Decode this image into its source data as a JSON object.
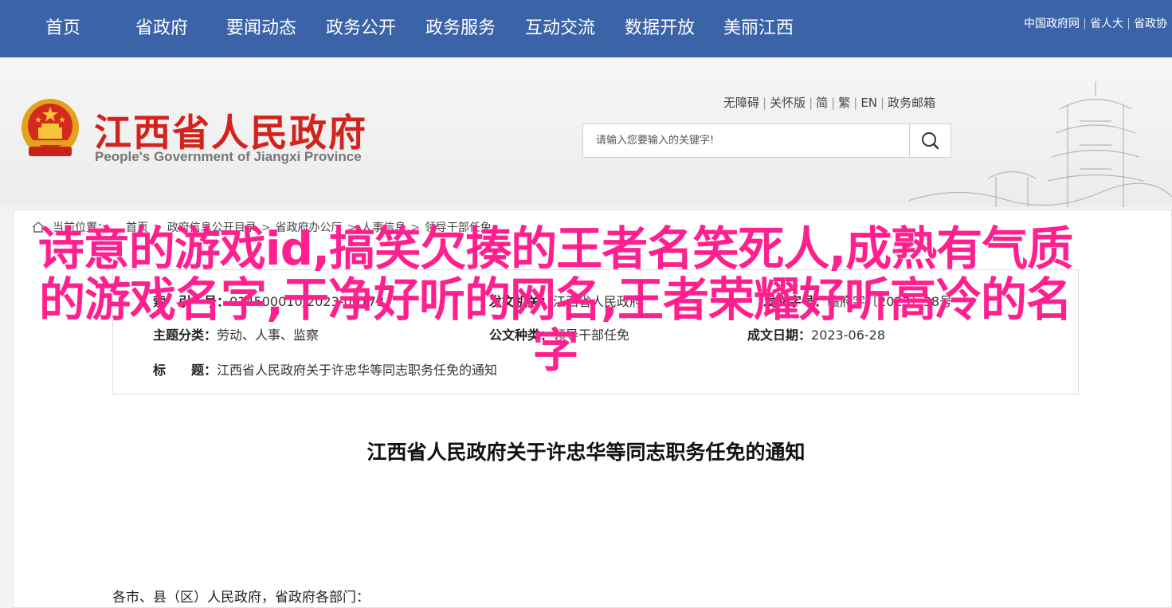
{
  "topnav": {
    "items": [
      "首页",
      "省政府",
      "要闻动态",
      "政务公开",
      "政务服务",
      "互动交流",
      "数据开放",
      "美丽江西"
    ],
    "links": [
      "中国政府网",
      "省人大",
      "省政协"
    ]
  },
  "header": {
    "title": "江西省人民政府",
    "subtitle": "People's Government of Jiangxi Province",
    "util_links": [
      "无障碍",
      "关怀版",
      "简",
      "繁",
      "EN",
      "政务邮箱"
    ],
    "search_placeholder": "请输入您要输入的关键字!"
  },
  "breadcrumb": {
    "label": "当前位置：",
    "items": [
      "首页",
      "政府信息公开目录",
      "省政府办公厅",
      "人事信息",
      "领导干部任免"
    ]
  },
  "info": {
    "index_label": "索　引　号：",
    "index_value": "014500010/2023-00173",
    "issuer_label": "发文机关：",
    "issuer_value": "江西省人民政府",
    "docno_label": "发文字号：",
    "docno_value": "赣府字〔2023〕38号",
    "category_label": "主题分类：",
    "category_value": "劳动、人事、监察",
    "doctype_label": "公文种类：",
    "doctype_value": "领导干部任免",
    "date_label": "成文日期：",
    "date_value": "2023-06-28",
    "title_label": "标　　题：",
    "title_value": "江西省人民政府关于许忠华等同志职务任免的通知"
  },
  "document": {
    "title": "江西省人民政府关于许忠华等同志职务任免的通知",
    "salutation": "各市、县（区）人民政府，省政府各部门："
  },
  "overlay_text": "诗意的游戏id,搞笑欠揍的王者名笑死人,成熟有气质的游戏名字,干净好听的网名,王者荣耀好听高冷的名字",
  "colors": {
    "nav": "#3b64a8",
    "title_red": "#d2231c",
    "overlay": "#ff1f8e"
  }
}
